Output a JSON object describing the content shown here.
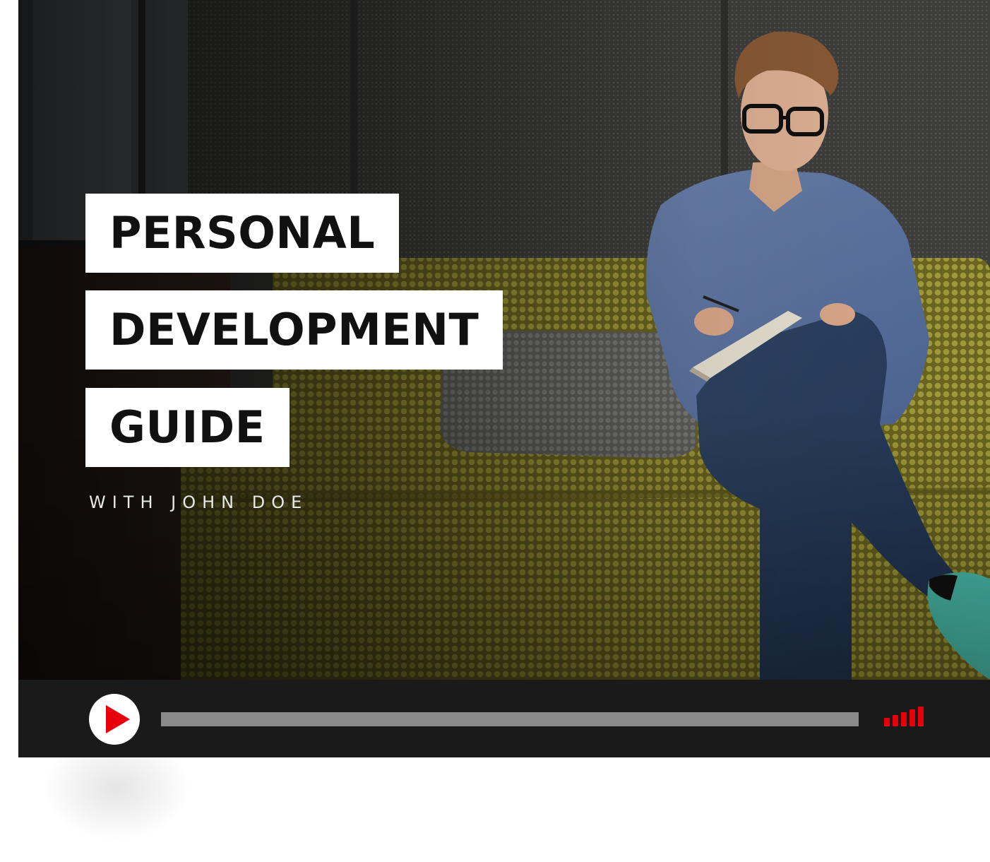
{
  "video": {
    "title_lines": [
      "PERSONAL",
      "DEVELOPMENT",
      "GUIDE"
    ],
    "subtitle": "WITH JOHN DOE",
    "thumbnail": "man-on-yellow-couch-writing-in-notebook"
  },
  "controls": {
    "play_icon": "play-icon",
    "progress_fraction": 0,
    "volume_icon": "volume-bars-icon",
    "volume_level_bars": 5
  },
  "colors": {
    "accent": "#e8000b",
    "control_bar": "#1a1a1a",
    "progress_track": "#8a8a8a",
    "title_box": "#ffffff",
    "title_text": "#111111"
  }
}
